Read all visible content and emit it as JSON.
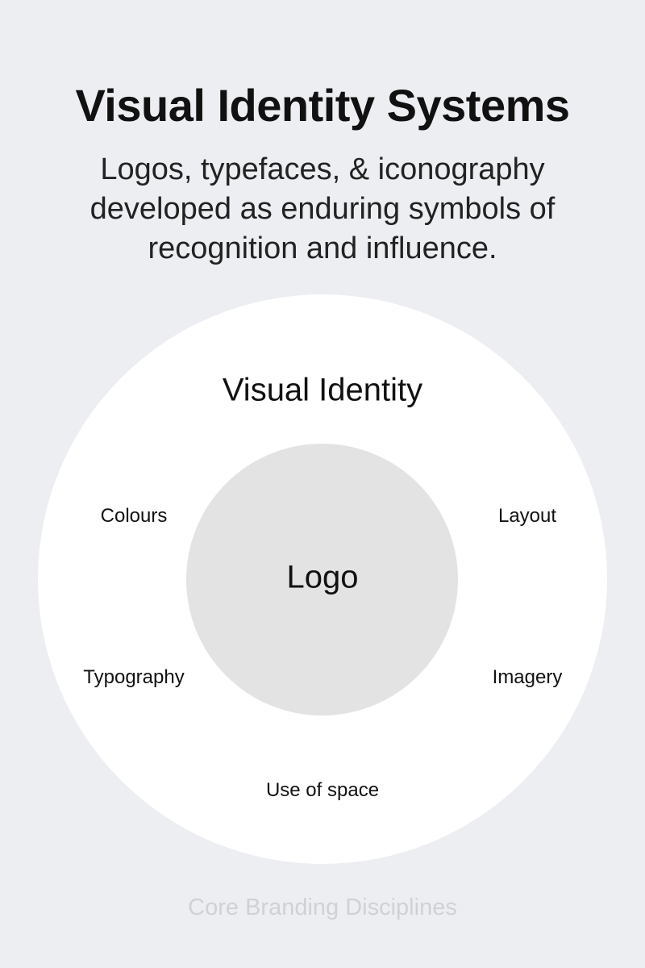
{
  "header": {
    "title": "Visual Identity Systems",
    "subtitle": "Logos, typefaces, & iconography developed as enduring symbols of recognition and influence."
  },
  "diagram": {
    "outer_label": "Visual Identity",
    "center_label": "Logo",
    "items": [
      "Colours",
      "Layout",
      "Typography",
      "Imagery",
      "Use of space"
    ],
    "colors": {
      "background": "#edeef2",
      "outer_circle": "#ffffff",
      "inner_circle": "#e3e3e3"
    }
  },
  "footer": {
    "text": "Core Branding Disciplines"
  }
}
